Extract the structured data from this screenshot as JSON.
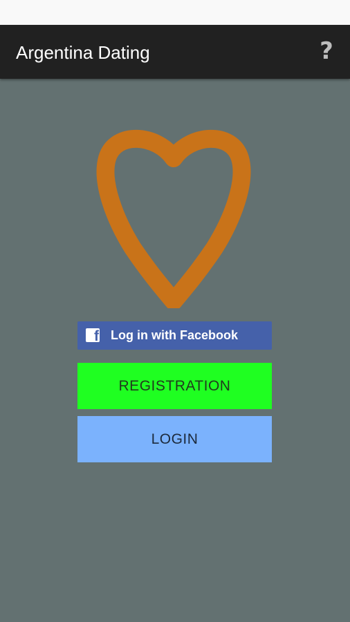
{
  "colors": {
    "background": "#637171",
    "app_bar": "#212121",
    "status_bar": "#f9f9f9",
    "heart_stroke": "#c97319",
    "facebook_blue": "#4561aa",
    "registration_green": "#1fff21",
    "login_blue": "#7bb2fd"
  },
  "app_bar": {
    "title": "Argentina Dating",
    "help_label": "?",
    "help_icon": "question-mark-icon"
  },
  "logo": {
    "icon": "heart-outline-icon"
  },
  "facebook": {
    "icon": "facebook-f-icon",
    "icon_glyph": "f",
    "label": "Log in with Facebook"
  },
  "buttons": {
    "registration_label": "REGISTRATION",
    "login_label": "LOGIN"
  }
}
